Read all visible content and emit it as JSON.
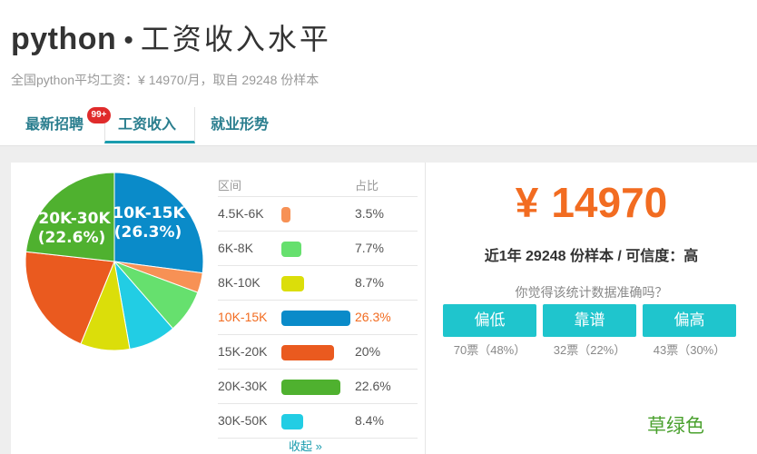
{
  "header": {
    "lang": "python",
    "dot": "•",
    "title": "工资收入水平",
    "subtitle": "全国python平均工资：¥ 14970/月，取自 29248 份样本"
  },
  "tabs": [
    {
      "label": "最新招聘",
      "badge": "99+"
    },
    {
      "label": "工资收入"
    },
    {
      "label": "就业形势"
    }
  ],
  "table": {
    "col_range": "区间",
    "col_pct": "占比",
    "rows": [
      {
        "range": "4.5K-6K",
        "pct": "3.5%",
        "color": "#f79155"
      },
      {
        "range": "6K-8K",
        "pct": "7.7%",
        "color": "#66e06e"
      },
      {
        "range": "8K-10K",
        "pct": "8.7%",
        "color": "#dbde0a"
      },
      {
        "range": "10K-15K",
        "pct": "26.3%",
        "color": "#0a8bc9"
      },
      {
        "range": "15K-20K",
        "pct": "20%",
        "color": "#ea5a1f"
      },
      {
        "range": "20K-30K",
        "pct": "22.6%",
        "color": "#4fb12f"
      },
      {
        "range": "30K-50K",
        "pct": "8.4%",
        "color": "#22cde4"
      }
    ],
    "collapse": "收起 »"
  },
  "pie_labels": {
    "a_line1": "10K-15K",
    "a_line2": "(26.3%)",
    "b_line1": "20K-30K",
    "b_line2": "(22.6%)"
  },
  "summary": {
    "yen": "¥",
    "avg": "14970",
    "sample_line": "近1年 29248 份样本 / 可信度：高",
    "question": "你觉得该统计数据准确吗？"
  },
  "votes": [
    {
      "label": "偏低",
      "count": "70票（48%）"
    },
    {
      "label": "靠谱",
      "count": "32票（22%）"
    },
    {
      "label": "偏高",
      "count": "43票（30%）"
    }
  ],
  "note": "草绿色",
  "chart_data": {
    "type": "pie",
    "categories": [
      "4.5K-6K",
      "6K-8K",
      "8K-10K",
      "10K-15K",
      "15K-20K",
      "20K-30K",
      "30K-50K"
    ],
    "values": [
      3.5,
      7.7,
      8.7,
      26.3,
      20,
      22.6,
      8.4
    ],
    "colors": [
      "#f79155",
      "#66e06e",
      "#dbde0a",
      "#0a8bc9",
      "#ea5a1f",
      "#4fb12f",
      "#22cde4"
    ]
  }
}
